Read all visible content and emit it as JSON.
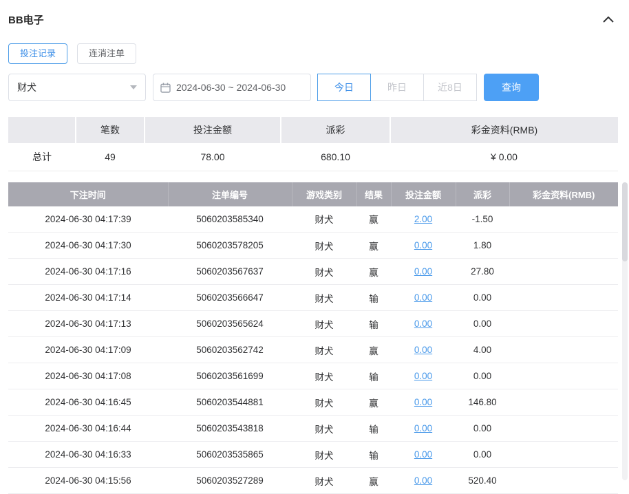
{
  "header": {
    "title": "BB电子"
  },
  "tabs": [
    {
      "label": "投注记录",
      "active": true
    },
    {
      "label": "连消注单",
      "active": false
    }
  ],
  "filters": {
    "game_select": {
      "value": "财犬"
    },
    "date_range": {
      "value": "2024-06-30 ~ 2024-06-30"
    },
    "quick_buttons": [
      {
        "label": "今日",
        "active": true
      },
      {
        "label": "昨日",
        "active": false
      },
      {
        "label": "近8日",
        "active": false
      }
    ],
    "search_label": "查询"
  },
  "summary": {
    "headers": [
      "",
      "笔数",
      "投注金额",
      "派彩",
      "彩金资料(RMB)"
    ],
    "row": {
      "label": "总计",
      "count": "49",
      "bet_amount": "78.00",
      "payout": "680.10",
      "bonus": "¥ 0.00"
    }
  },
  "table": {
    "headers": [
      "下注时间",
      "注单编号",
      "游戏类别",
      "结果",
      "投注金额",
      "派彩",
      "彩金资料(RMB)"
    ],
    "rows": [
      {
        "time": "2024-06-30 04:17:39",
        "order": "5060203585340",
        "game": "财犬",
        "result": "赢",
        "bet": "2.00",
        "payout": "-1.50",
        "bonus": ""
      },
      {
        "time": "2024-06-30 04:17:30",
        "order": "5060203578205",
        "game": "财犬",
        "result": "赢",
        "bet": "0.00",
        "payout": "1.80",
        "bonus": ""
      },
      {
        "time": "2024-06-30 04:17:16",
        "order": "5060203567637",
        "game": "财犬",
        "result": "赢",
        "bet": "0.00",
        "payout": "27.80",
        "bonus": ""
      },
      {
        "time": "2024-06-30 04:17:14",
        "order": "5060203566647",
        "game": "财犬",
        "result": "输",
        "bet": "0.00",
        "payout": "0.00",
        "bonus": ""
      },
      {
        "time": "2024-06-30 04:17:13",
        "order": "5060203565624",
        "game": "财犬",
        "result": "输",
        "bet": "0.00",
        "payout": "0.00",
        "bonus": ""
      },
      {
        "time": "2024-06-30 04:17:09",
        "order": "5060203562742",
        "game": "财犬",
        "result": "赢",
        "bet": "0.00",
        "payout": "4.00",
        "bonus": ""
      },
      {
        "time": "2024-06-30 04:17:08",
        "order": "5060203561699",
        "game": "财犬",
        "result": "输",
        "bet": "0.00",
        "payout": "0.00",
        "bonus": ""
      },
      {
        "time": "2024-06-30 04:16:45",
        "order": "5060203544881",
        "game": "财犬",
        "result": "赢",
        "bet": "0.00",
        "payout": "146.80",
        "bonus": ""
      },
      {
        "time": "2024-06-30 04:16:44",
        "order": "5060203543818",
        "game": "财犬",
        "result": "输",
        "bet": "0.00",
        "payout": "0.00",
        "bonus": ""
      },
      {
        "time": "2024-06-30 04:16:33",
        "order": "5060203535865",
        "game": "财犬",
        "result": "输",
        "bet": "0.00",
        "payout": "0.00",
        "bonus": ""
      },
      {
        "time": "2024-06-30 04:15:56",
        "order": "5060203527289",
        "game": "财犬",
        "result": "赢",
        "bet": "0.00",
        "payout": "520.40",
        "bonus": ""
      }
    ]
  },
  "colors": {
    "accent_blue": "#4b9ce8",
    "button_blue": "#4da0f5",
    "negative_red": "#f05a5a",
    "table_header_gray": "#a8a8b0",
    "summary_header_gray": "#e9e9ed"
  }
}
